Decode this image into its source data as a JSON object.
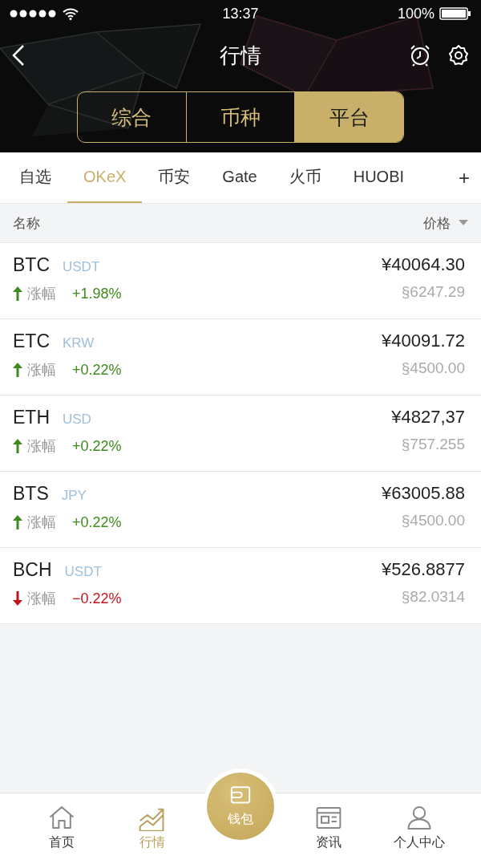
{
  "status_bar": {
    "time": "13:37",
    "battery": "100%"
  },
  "nav": {
    "title": "行情"
  },
  "segments": [
    {
      "label": "综合",
      "selected": false
    },
    {
      "label": "币种",
      "selected": false
    },
    {
      "label": "平台",
      "selected": true
    }
  ],
  "tabs": [
    {
      "label": "自选",
      "selected": false
    },
    {
      "label": "OKeX",
      "selected": true
    },
    {
      "label": "币安",
      "selected": false
    },
    {
      "label": "Gate",
      "selected": false
    },
    {
      "label": "火币",
      "selected": false
    },
    {
      "label": "HUOBI",
      "selected": false
    }
  ],
  "add_tab": "+",
  "columns": {
    "name": "名称",
    "price": "价格"
  },
  "rows": [
    {
      "symbol": "BTC",
      "quote": "USDT",
      "change_label": "涨幅",
      "change": "+1.98%",
      "kind": "up",
      "price": "¥40064.30",
      "alt_price": "§6247.29"
    },
    {
      "symbol": "ETC",
      "quote": "KRW",
      "change_label": "涨幅",
      "change": "+0.22%",
      "kind": "up",
      "price": "¥40091.72",
      "alt_price": "§4500.00"
    },
    {
      "symbol": "ETH",
      "quote": "USD",
      "change_label": "涨幅",
      "change": "+0.22%",
      "kind": "up",
      "price": "¥4827,37",
      "alt_price": "§757.255"
    },
    {
      "symbol": "BTS",
      "quote": "JPY",
      "change_label": "涨幅",
      "change": "+0.22%",
      "kind": "up",
      "price": "¥63005.88",
      "alt_price": "§4500.00"
    },
    {
      "symbol": "BCH",
      "quote": "USDT",
      "change_label": "涨幅",
      "change": "−0.22%",
      "kind": "down",
      "price": "¥526.8877",
      "alt_price": "§82.0314"
    }
  ],
  "bottom_nav": [
    {
      "label": "首页",
      "kind": "home",
      "selected": false
    },
    {
      "label": "行情",
      "kind": "market",
      "selected": true
    },
    {
      "label": "钱包",
      "kind": "wallet",
      "selected": false
    },
    {
      "label": "资讯",
      "kind": "news",
      "selected": false
    },
    {
      "label": "个人中心",
      "kind": "profile",
      "selected": false
    }
  ]
}
